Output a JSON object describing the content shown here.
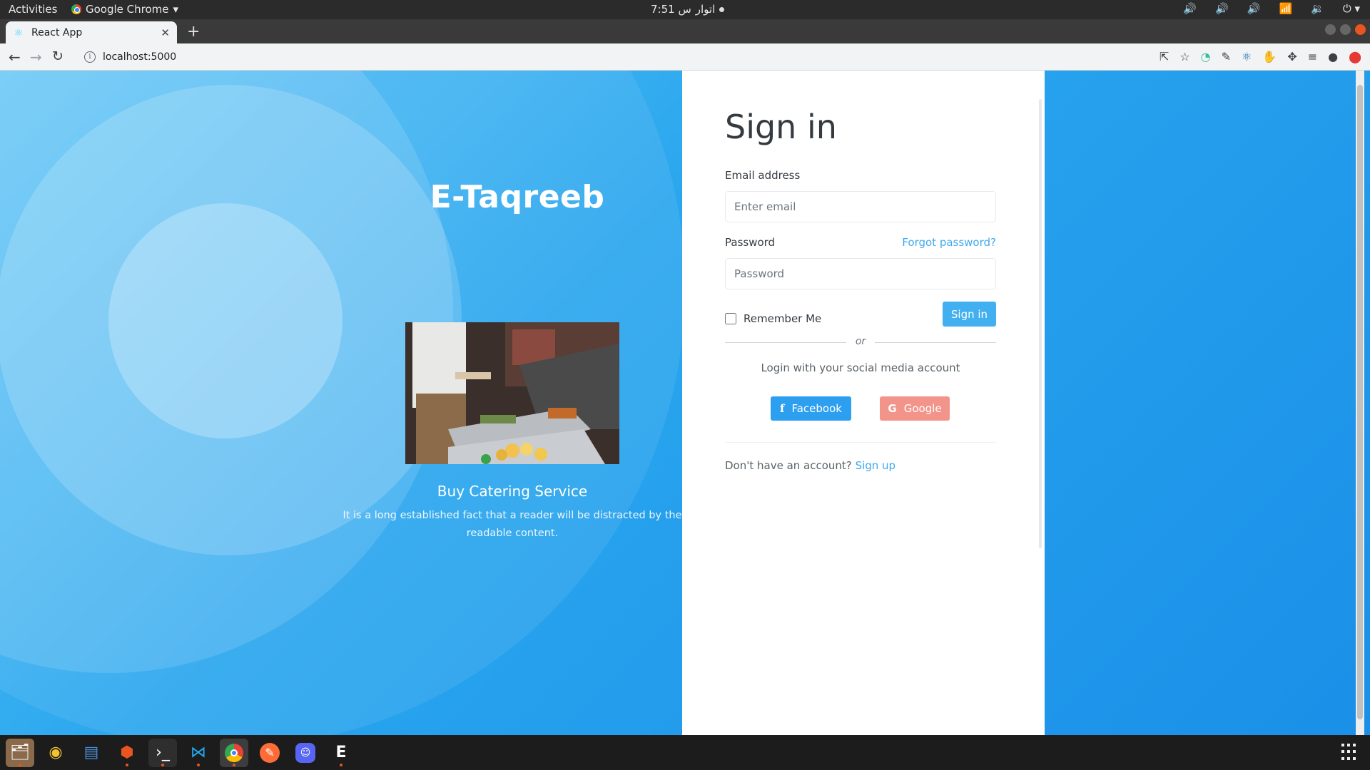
{
  "system": {
    "activities": "Activities",
    "app_menu": "Google Chrome",
    "clock": "7:51 ﺱ",
    "clock_day": "اتوار"
  },
  "browser": {
    "tab_title": "React App",
    "url": "localhost:5000"
  },
  "hero": {
    "brand": "E-Taqreeb",
    "service_title": "Buy Catering Service",
    "service_description": "It is a long established fact that a reader will be distracted by the readable content."
  },
  "signin": {
    "title": "Sign in",
    "email_label": "Email address",
    "email_placeholder": "Enter email",
    "password_label": "Password",
    "password_placeholder": "Password",
    "forgot_password": "Forgot password?",
    "remember_me": "Remember Me",
    "submit": "Sign in",
    "or": "or",
    "social_text": "Login with your social media account",
    "facebook": "Facebook",
    "google": "Google",
    "no_account": "Don't have an account?",
    "signup": "Sign up"
  },
  "colors": {
    "primary": "#42b0f0",
    "facebook": "#2d9ff0",
    "google": "#f3948a",
    "background_gradient_start": "#5cc3f6",
    "background_gradient_end": "#1a8fe8"
  }
}
